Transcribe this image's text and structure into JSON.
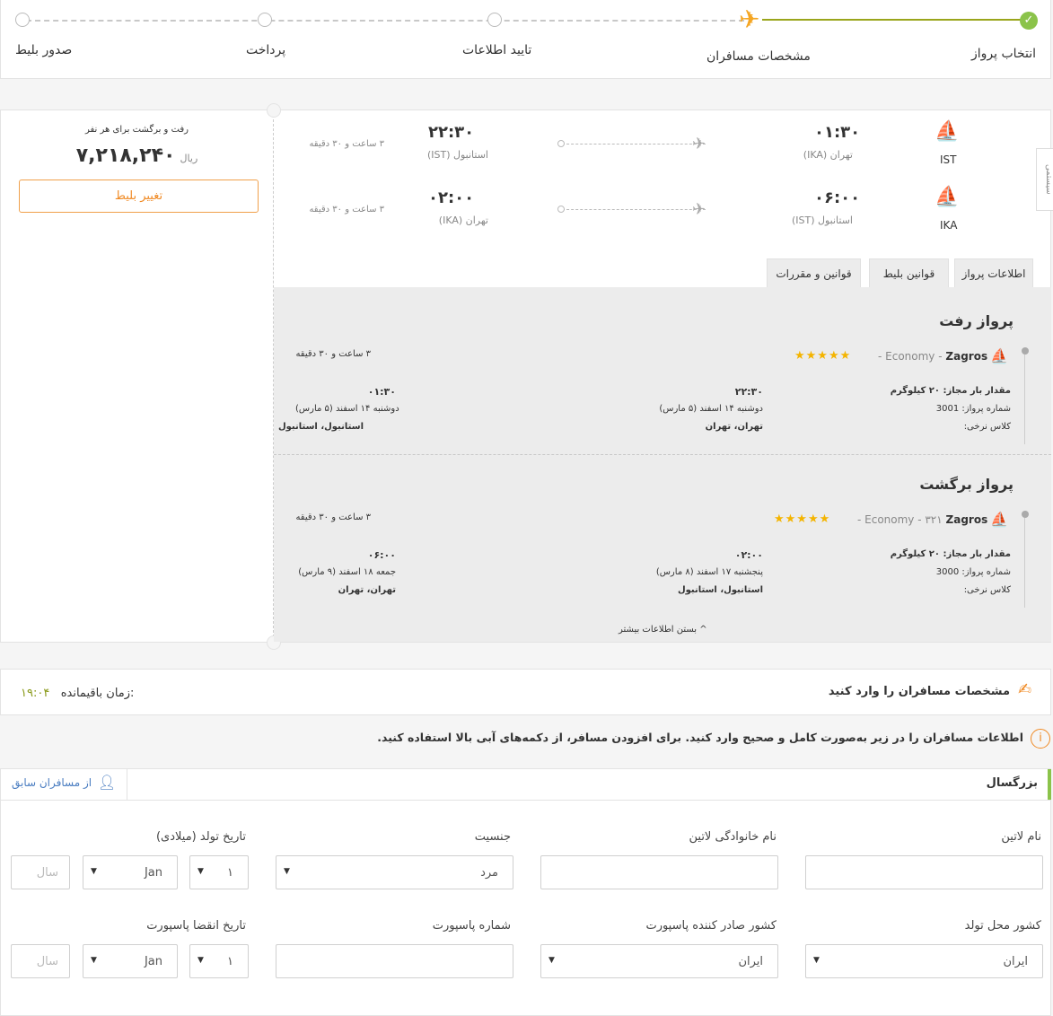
{
  "steps": [
    "انتخاب پرواز",
    "مشخصات مسافران",
    "تایید اطلاعات",
    "پرداخت",
    "صدور بلیط"
  ],
  "price": {
    "caption": "رفت و برگشت برای هر نفر",
    "amount": "۷,۲۱۸,۲۴۰",
    "unit": "ریال",
    "change_label": "تغییر بلیط"
  },
  "side_tab": "سیستمی",
  "legs": [
    {
      "code": "IST",
      "dep_time": "۰۱:۳۰",
      "dep_place": "تهران (IKA)",
      "arr_time": "۲۲:۳۰",
      "arr_place": "استانبول (IST)",
      "duration": "۳ ساعت و ۳۰ دقیقه"
    },
    {
      "code": "IKA",
      "dep_time": "۰۶:۰۰",
      "dep_place": "استانبول (IST)",
      "arr_time": "۰۲:۰۰",
      "arr_place": "تهران (IKA)",
      "duration": "۳ ساعت و ۳۰ دقیقه"
    }
  ],
  "tabs": [
    "اطلاعات پرواز",
    "قوانین بلیط",
    "قوانین و مقررات"
  ],
  "details": [
    {
      "title": "پرواز رفت",
      "airline": "Zagros",
      "cabin": "- Economy -",
      "stars": "★★★★★",
      "duration": "۳ ساعت و ۳۰ دقیقه",
      "baggage": "مقدار بار مجاز: ۲۰ کیلوگرم",
      "flight_no": "شماره پرواز: 3001",
      "fare_class": "کلاس نرخی:",
      "mid_time": "۲۲:۳۰",
      "mid_date": "دوشنبه ۱۴ اسفند (۵ مارس)",
      "mid_place": "تهران، تهران",
      "end_time": "۰۱:۳۰",
      "end_date": "دوشنبه ۱۴ اسفند (۵ مارس)",
      "end_place": "استانبول، استانبول"
    },
    {
      "title": "پرواز برگشت",
      "airline": "Zagros",
      "cabin": "- Economy - ۳۲۱",
      "stars": "★★★★★",
      "duration": "۳ ساعت و ۳۰ دقیقه",
      "baggage": "مقدار بار مجاز: ۲۰ کیلوگرم",
      "flight_no": "شماره پرواز: 3000",
      "fare_class": "کلاس نرخی:",
      "mid_time": "۰۲:۰۰",
      "mid_date": "پنجشنبه ۱۷ اسفند (۸ مارس)",
      "mid_place": "استانبول، استانبول",
      "end_time": "۰۶:۰۰",
      "end_date": "جمعه ۱۸ اسفند (۹ مارس)",
      "end_place": "تهران، تهران"
    }
  ],
  "close_more": "بستن اطلاعات بیشتر",
  "passengers": {
    "title": "مشخصات مسافران را وارد کنید",
    "timer_label": "زمان باقیمانده:",
    "timer": "۱۹:۰۴",
    "notice": "اطلاعات مسافران را در زیر به‌صورت کامل و صحیح وارد کنید. برای افزودن مسافر، از دکمه‌های آبی بالا استفاده کنید.",
    "type": "بزرگسال",
    "previous": "از مسافران سابق",
    "labels": {
      "latin_name": "نام لاتین",
      "latin_family": "نام خانوادگی لاتین",
      "gender": "جنسیت",
      "birth": "تاریخ تولد (میلادی)",
      "birth_country": "کشور محل تولد",
      "passport_country": "کشور صادر کننده پاسپورت",
      "passport_no": "شماره پاسپورت",
      "passport_exp": "تاریخ انقضا پاسپورت"
    },
    "gender_value": "مرد",
    "day": "۱",
    "month": "Jan",
    "year_placeholder": "سال",
    "country": "ایران"
  }
}
